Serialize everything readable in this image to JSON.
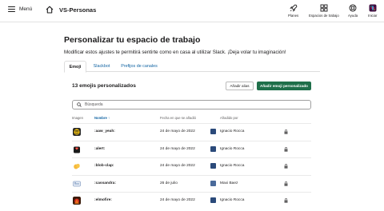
{
  "topbar": {
    "menu_label": "Menú",
    "workspace_name": "VS-Personas",
    "nav": [
      {
        "label": "Planes",
        "icon": "rocket-icon"
      },
      {
        "label": "Espacios de trabajo",
        "icon": "grid-icon"
      },
      {
        "label": "Ayuda",
        "icon": "help-lifebuoy-icon"
      },
      {
        "label": "Iniciar",
        "icon": "slack-logo-icon"
      }
    ]
  },
  "page": {
    "title": "Personalizar tu espacio de trabajo",
    "subtitle": "Modificar estos ajustes te permitirá sentirte como en casa al utilizar Slack. ¡Deja volar tu imaginación!"
  },
  "tabs": [
    "Emoji",
    "Slackbot",
    "Prefijos de canales"
  ],
  "emoji_panel": {
    "count_title": "13 emojis personalizados",
    "add_alias_label": "Añadir alias",
    "add_emoji_label": "Añadir emoji personalizado",
    "search_placeholder": "Búsqueda",
    "columns": {
      "image": "Imagen",
      "name": "Nombre",
      "sort_arrow": "↑",
      "date": "Fecha en que se añadió",
      "added_by": "Añadido por"
    },
    "rows": [
      {
        "name": ":aaw_yeah:",
        "date": "24 de mayo de 2022",
        "added_by": "Ignacio Rocca"
      },
      {
        "name": ":alert:",
        "date": "24 de mayo de 2022",
        "added_by": "Ignacio Rocca"
      },
      {
        "name": ":blob-clap:",
        "date": "24 de mayo de 2022",
        "added_by": "Ignacio Rocca"
      },
      {
        "name": ":cassandra:",
        "date": "26 de julio",
        "added_by": "Maxi Baez"
      },
      {
        "name": ":elmofire:",
        "date": "24 de mayo de 2022",
        "added_by": "Ignacio Rocca"
      }
    ]
  },
  "colors": {
    "primary_button": "#1f6f4a",
    "link": "#1264a3",
    "text": "#1d1c1d"
  }
}
